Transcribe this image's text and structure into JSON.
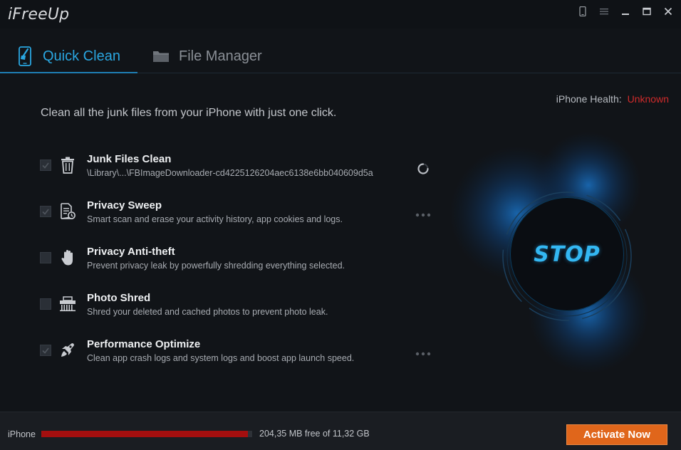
{
  "app": {
    "title": "iFreeUp"
  },
  "window_controls": [
    "phone-icon",
    "menu-icon",
    "minimize-icon",
    "maximize-icon",
    "close-icon"
  ],
  "tabs": [
    {
      "label": "Quick Clean",
      "icon": "phone-brush-icon",
      "active": true
    },
    {
      "label": "File Manager",
      "icon": "folder-icon",
      "active": false
    }
  ],
  "health": {
    "label": "iPhone Health:",
    "value": "Unknown",
    "value_color": "#cf2b2b"
  },
  "intro": "Clean all the junk files from your iPhone with just one click.",
  "items": [
    {
      "title": "Junk Files Clean",
      "desc": "\\Library\\...\\FBImageDownloader-cd4225126204aec6138e6bb040609d5a",
      "checked": true,
      "icon": "trash-icon",
      "state": "spinner-icon"
    },
    {
      "title": "Privacy Sweep",
      "desc": "Smart scan and erase your activity history, app cookies and logs.",
      "checked": true,
      "icon": "document-clock-icon",
      "state": "dots-icon"
    },
    {
      "title": "Privacy Anti-theft",
      "desc": "Prevent privacy leak by powerfully shredding everything selected.",
      "checked": false,
      "icon": "hand-icon",
      "state": ""
    },
    {
      "title": "Photo Shred",
      "desc": "Shred your deleted and cached photos to prevent photo leak.",
      "checked": false,
      "icon": "shredder-icon",
      "state": ""
    },
    {
      "title": "Performance Optimize",
      "desc": "Clean app crash logs and system logs and boost app launch speed.",
      "checked": true,
      "icon": "rocket-icon",
      "state": "dots-icon"
    }
  ],
  "stop": {
    "label": "STOP",
    "accent": "#33b7f2"
  },
  "bottom": {
    "device": "iPhone",
    "storage_used_fraction": 0.98,
    "storage_text": "204,35 MB free of 11,32 GB",
    "activate_label": "Activate Now",
    "activate_color": "#e0661b"
  }
}
